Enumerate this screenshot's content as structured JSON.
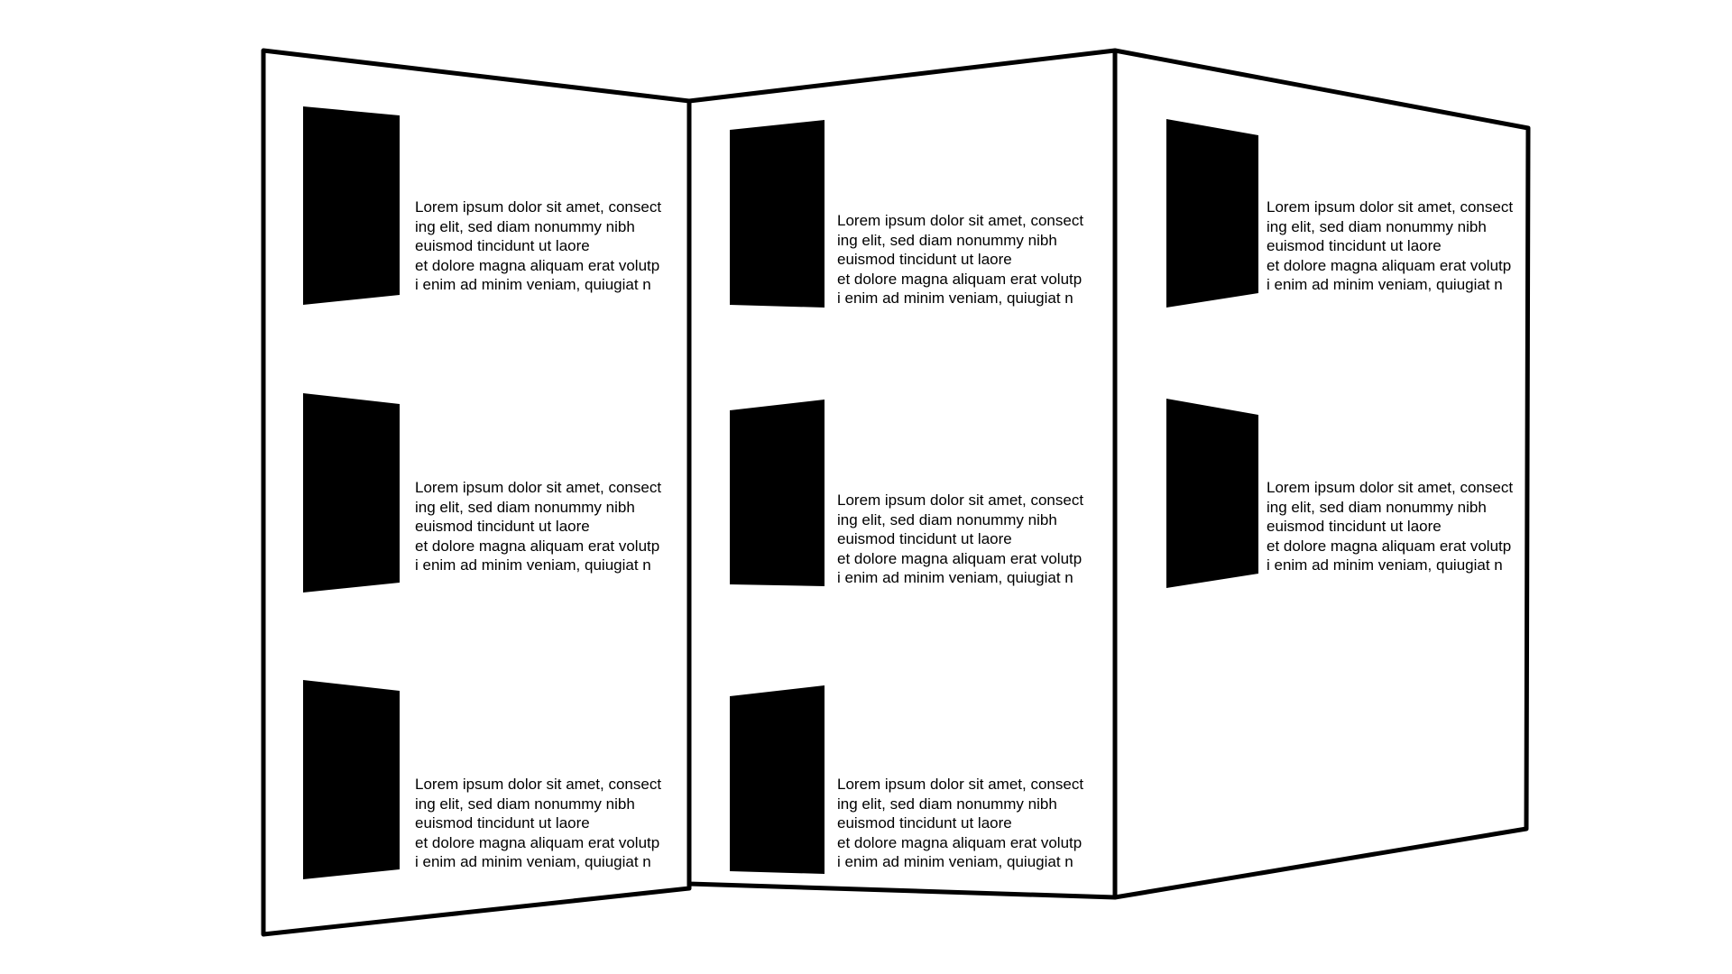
{
  "colors": {
    "background": "#ffffff",
    "outline": "#000000",
    "image_fill": "#000000",
    "text": "#000000"
  },
  "lorem_lines": [
    "Lorem ipsum dolor sit amet, consect",
    "ing elit, sed diam nonummy nibh",
    "euismod tincidunt ut laore",
    "et dolore magna aliquam erat volutp",
    "i enim ad minim veniam, quiugiat n"
  ],
  "panels": [
    {
      "name": "left-panel",
      "items": [
        {
          "lines": [
            "Lorem ipsum dolor sit amet, consect",
            "ing elit, sed diam nonummy nibh",
            "euismod tincidunt ut laore",
            "et dolore magna aliquam erat volutp",
            "i enim ad minim veniam, quiugiat n"
          ]
        },
        {
          "lines": [
            "Lorem ipsum dolor sit amet, consect",
            "ing elit, sed diam nonummy nibh",
            "euismod tincidunt ut laore",
            "et dolore magna aliquam erat volutp",
            "i enim ad minim veniam, quiugiat n"
          ]
        },
        {
          "lines": [
            "Lorem ipsum dolor sit amet, consect",
            "ing elit, sed diam nonummy nibh",
            "euismod tincidunt ut laore",
            "et dolore magna aliquam erat volutp",
            "i enim ad minim veniam, quiugiat n"
          ]
        }
      ]
    },
    {
      "name": "middle-panel",
      "items": [
        {
          "lines": [
            "Lorem ipsum dolor sit amet, consect",
            "ing elit, sed diam nonummy nibh",
            "euismod tincidunt ut laore",
            "et dolore magna aliquam erat volutp",
            "i enim ad minim veniam, quiugiat n"
          ]
        },
        {
          "lines": [
            "Lorem ipsum dolor sit amet, consect",
            "ing elit, sed diam nonummy nibh",
            "euismod tincidunt ut laore",
            "et dolore magna aliquam erat volutp",
            "i enim ad minim veniam, quiugiat n"
          ]
        },
        {
          "lines": [
            "Lorem ipsum dolor sit amet, consect",
            "ing elit, sed diam nonummy nibh",
            "euismod tincidunt ut laore",
            "et dolore magna aliquam erat volutp",
            "i enim ad minim veniam, quiugiat n"
          ]
        }
      ]
    },
    {
      "name": "right-panel",
      "items": [
        {
          "lines": [
            "Lorem ipsum dolor sit amet, consect",
            "ing elit, sed diam nonummy nibh",
            "euismod tincidunt ut laore",
            "et dolore magna aliquam erat volutp",
            "i enim ad minim veniam, quiugiat n"
          ]
        },
        {
          "lines": [
            "Lorem ipsum dolor sit amet, consect",
            "ing elit, sed diam nonummy nibh",
            "euismod tincidunt ut laore",
            "et dolore magna aliquam erat volutp",
            "i enim ad minim veniam, quiugiat n"
          ]
        }
      ]
    }
  ]
}
